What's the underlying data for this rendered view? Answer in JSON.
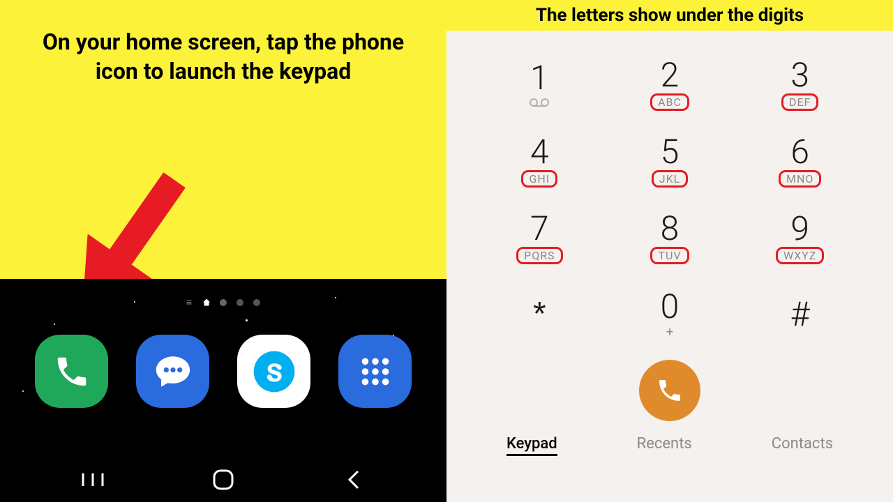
{
  "captions": {
    "left": "On your home screen, tap the phone icon to launch the keypad",
    "right": "The letters show under the digits"
  },
  "dock": {
    "phone": "phone-icon",
    "messages": "messages-icon",
    "skype": "skype-icon",
    "apps": "apps-icon"
  },
  "keypad": {
    "keys": [
      {
        "digit": "1",
        "letters": "",
        "voicemail": true
      },
      {
        "digit": "2",
        "letters": "ABC"
      },
      {
        "digit": "3",
        "letters": "DEF"
      },
      {
        "digit": "4",
        "letters": "GHI"
      },
      {
        "digit": "5",
        "letters": "JKL"
      },
      {
        "digit": "6",
        "letters": "MNO"
      },
      {
        "digit": "7",
        "letters": "PQRS"
      },
      {
        "digit": "8",
        "letters": "TUV"
      },
      {
        "digit": "9",
        "letters": "WXYZ"
      },
      {
        "digit": "*",
        "letters": ""
      },
      {
        "digit": "0",
        "letters": "",
        "plus": "+"
      },
      {
        "digit": "#",
        "letters": ""
      }
    ]
  },
  "tabs": {
    "keypad": "Keypad",
    "recents": "Recents",
    "contacts": "Contacts",
    "active": "keypad"
  },
  "colors": {
    "highlight": "#fdf23a",
    "arrow": "#e61b23",
    "letterBox": "#e61b23",
    "callBtn": "#e08a2e",
    "phoneApp": "#1fa85a",
    "blueApp": "#2a6bdd"
  }
}
